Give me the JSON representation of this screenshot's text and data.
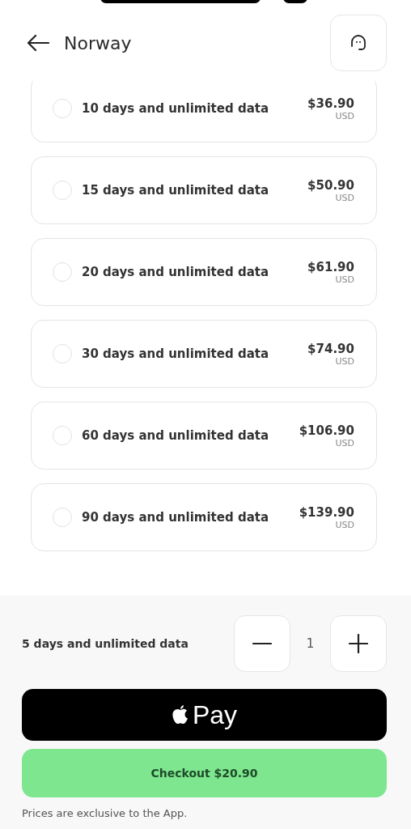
{
  "header": {
    "title": "Norway"
  },
  "plans": [
    {
      "name": "10 days and unlimited data",
      "price": "$36.90",
      "currency": "USD",
      "selected": false
    },
    {
      "name": "15 days and unlimited data",
      "price": "$50.90",
      "currency": "USD",
      "selected": false
    },
    {
      "name": "20 days and unlimited data",
      "price": "$61.90",
      "currency": "USD",
      "selected": false
    },
    {
      "name": "30 days and unlimited data",
      "price": "$74.90",
      "currency": "USD",
      "selected": false
    },
    {
      "name": "60 days and unlimited data",
      "price": "$106.90",
      "currency": "USD",
      "selected": false
    },
    {
      "name": "90 days and unlimited data",
      "price": "$139.90",
      "currency": "USD",
      "selected": false
    }
  ],
  "summary": {
    "plan": "5 days and unlimited data",
    "quantity": "1"
  },
  "apple_pay": {
    "label": "Pay"
  },
  "checkout": {
    "label": "Checkout $20.90"
  },
  "footer_note": "Prices are exclusive to the App."
}
